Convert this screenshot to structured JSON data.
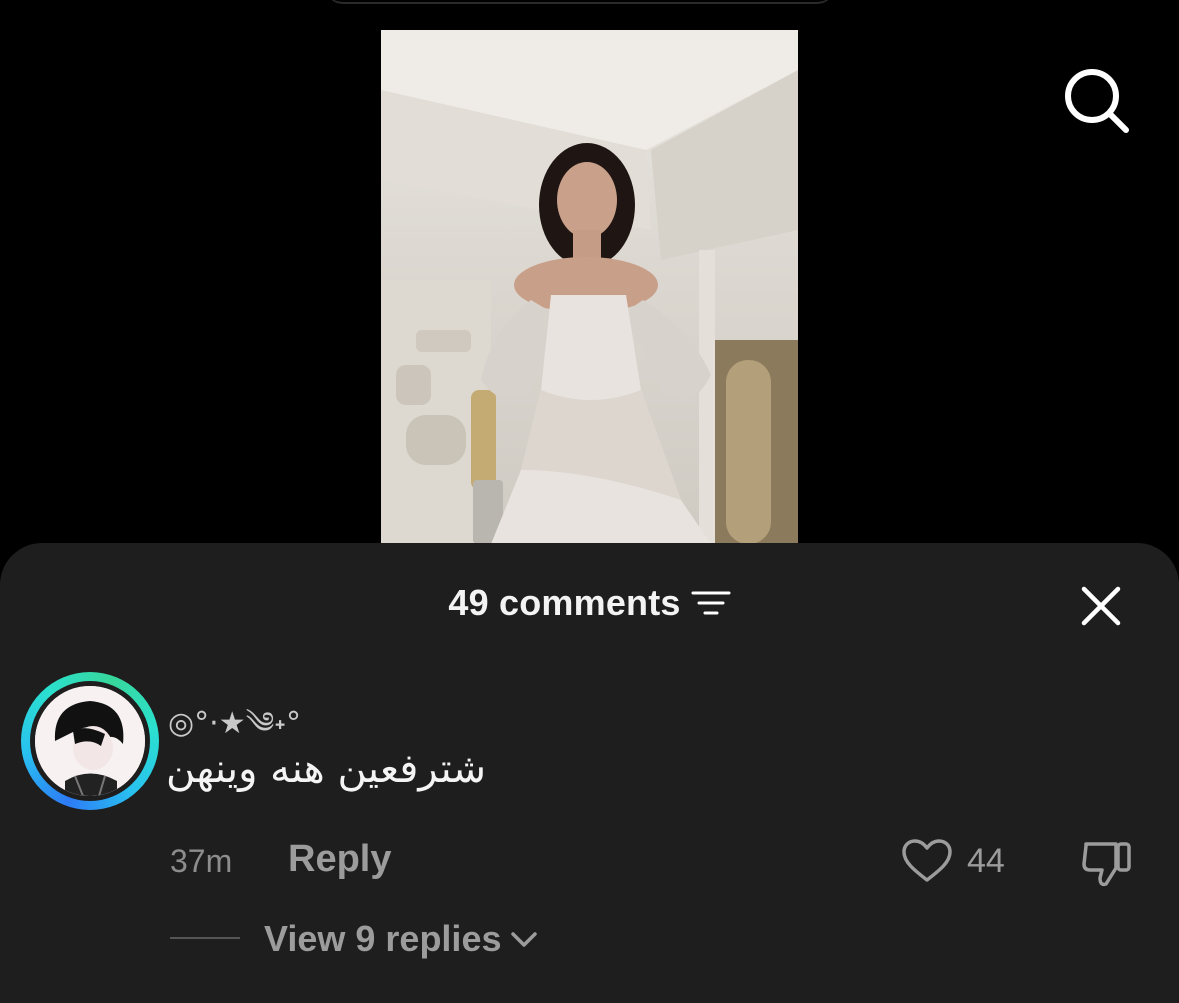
{
  "header": {
    "comments_count": "49 comments"
  },
  "icons": {
    "search": "search-icon",
    "filter": "filter-icon",
    "close": "close-icon",
    "like": "heart-icon",
    "dislike": "thumbs-down-icon",
    "expand": "chevron-down-icon"
  },
  "comment": {
    "username": "◎°·★༄˖°",
    "text": "شترفعين هنه وينهن",
    "timestamp": "37m",
    "reply_label": "Reply",
    "like_count": "44",
    "view_replies_label": "View 9 replies"
  },
  "colors": {
    "background": "#000000",
    "sheet": "#1e1e1e",
    "ring_start": "#2d7bf6",
    "ring_end": "#37d79b",
    "muted_text": "#9c9c9c"
  }
}
